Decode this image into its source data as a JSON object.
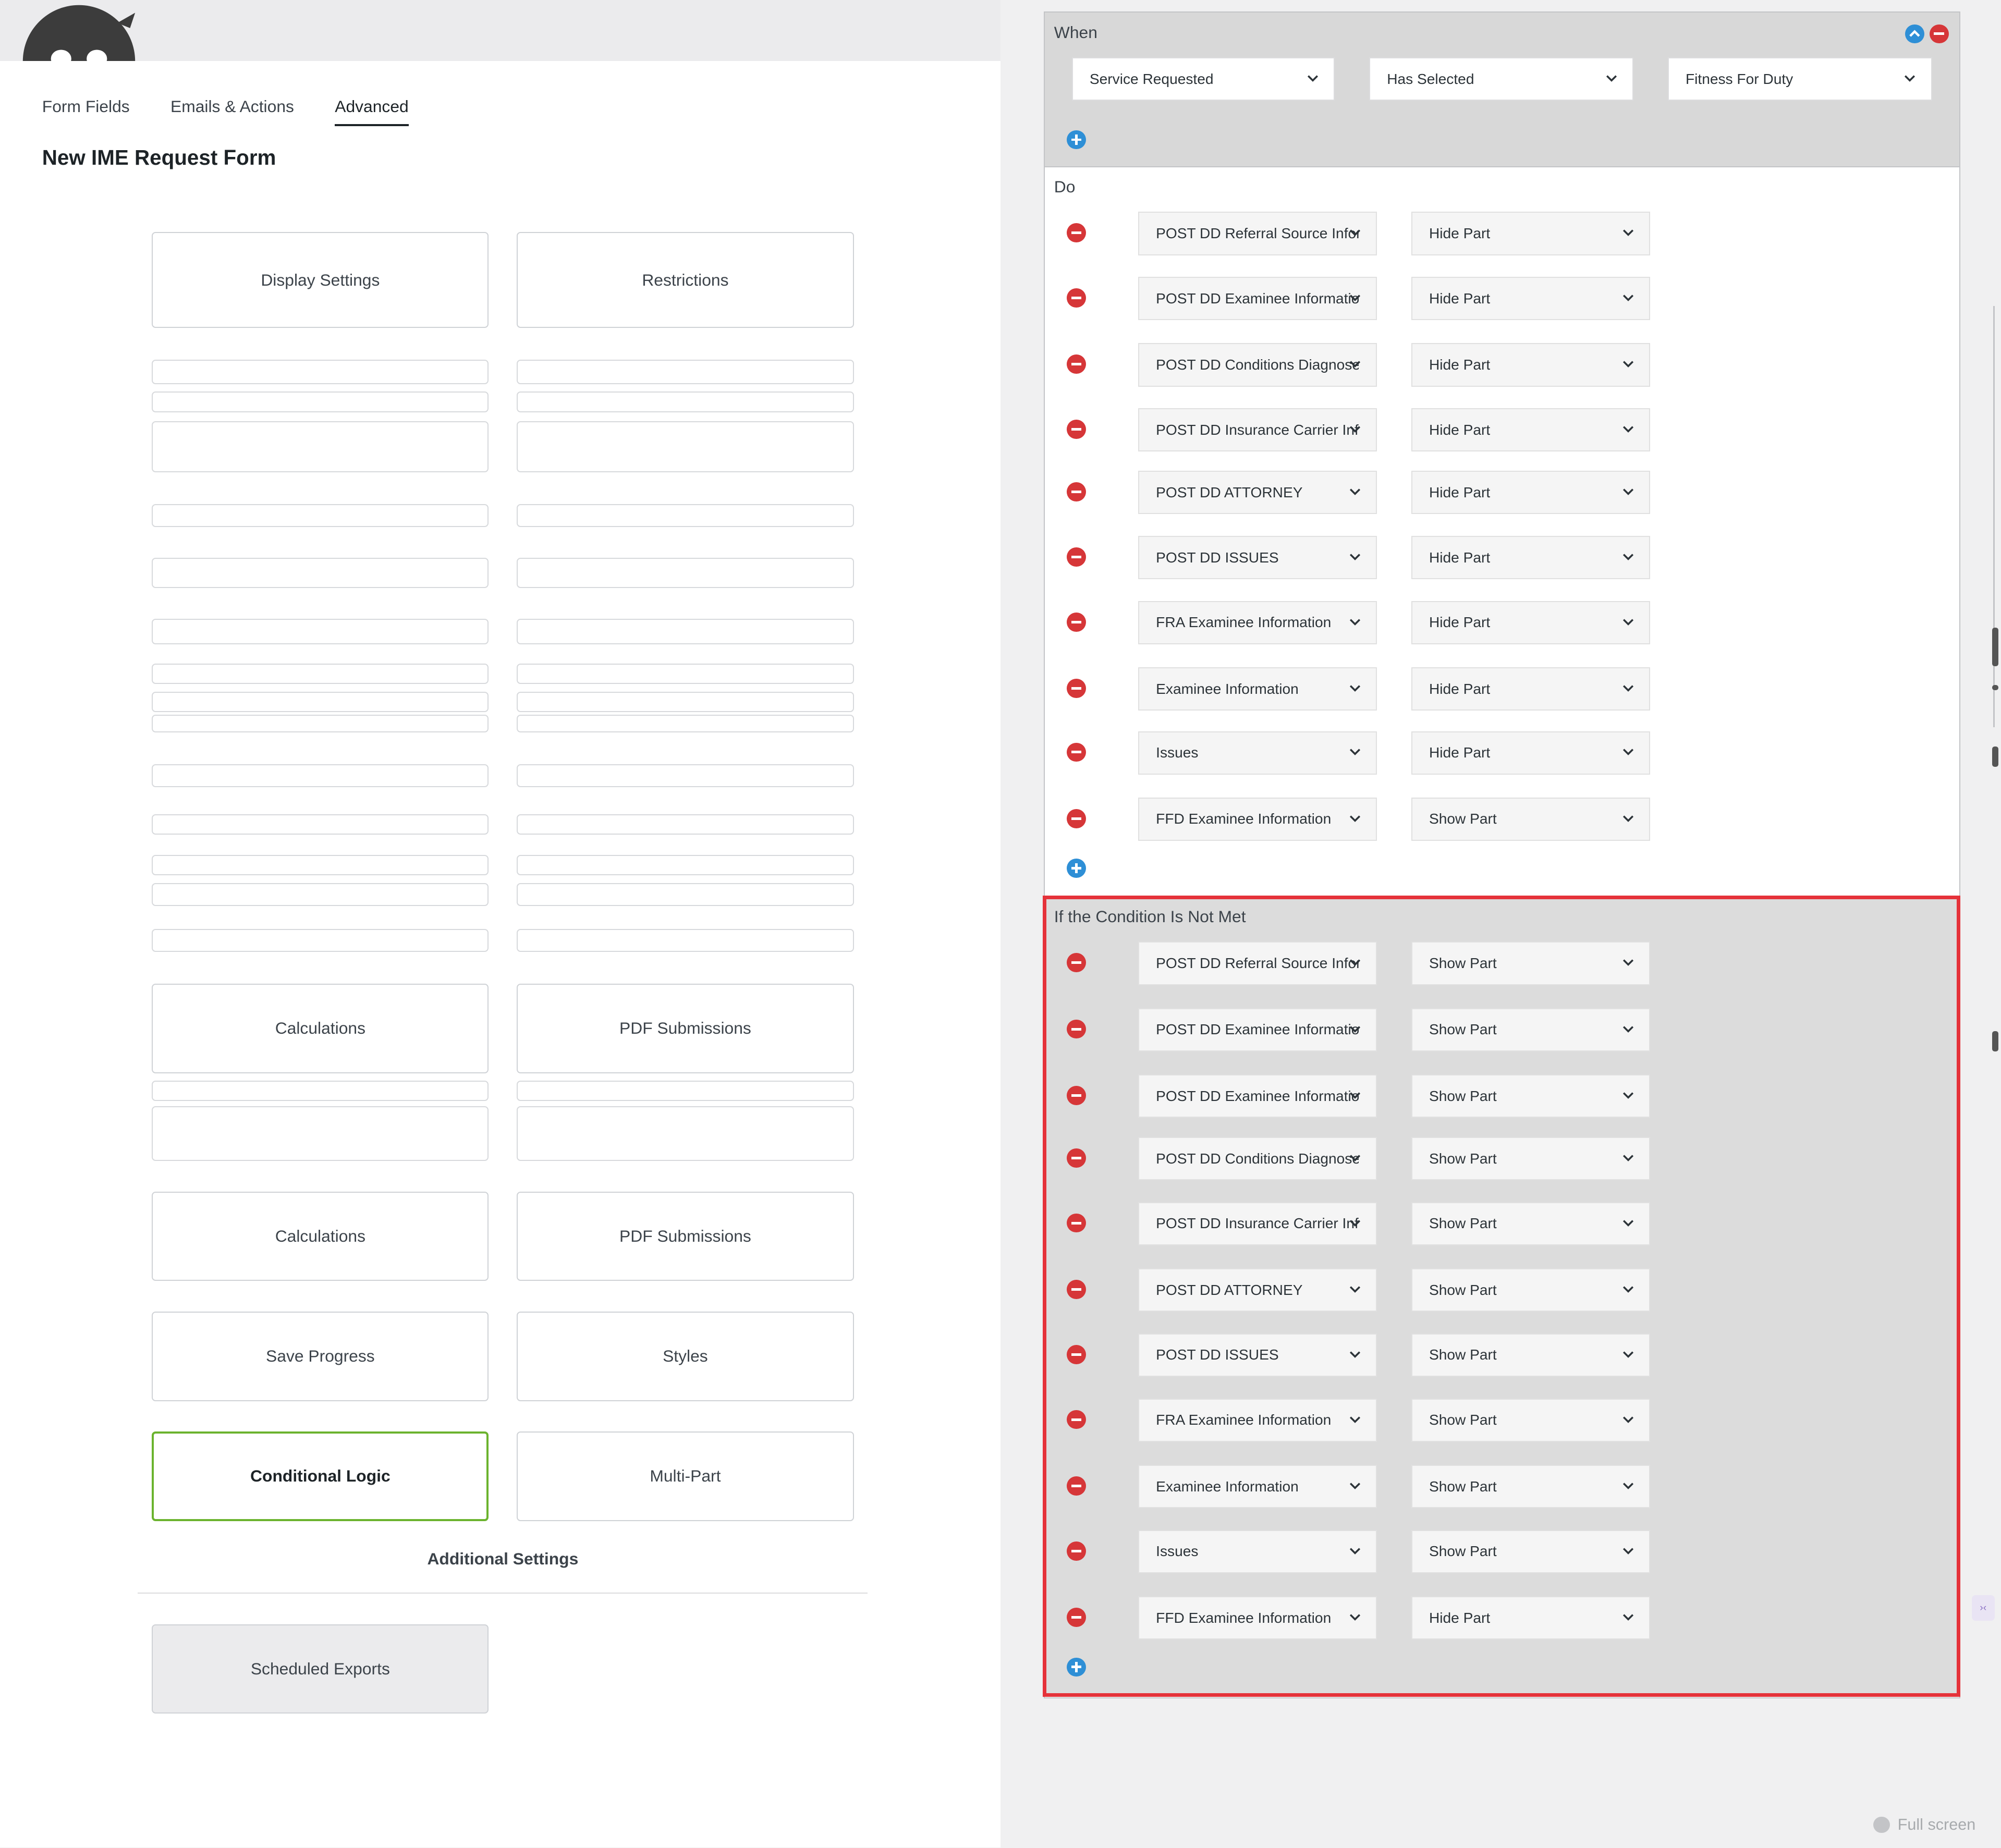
{
  "tabs": [
    "Form Fields",
    "Emails & Actions",
    "Advanced"
  ],
  "form_title": "New IME Request Form",
  "cards": {
    "display_settings": "Display Settings",
    "restrictions": "Restrictions",
    "calculations": "Calculations",
    "pdf_submissions": "PDF Submissions",
    "save_progress": "Save Progress",
    "styles": "Styles",
    "conditional_logic": "Conditional Logic",
    "multi_part": "Multi-Part",
    "additional_settings": "Additional Settings",
    "scheduled_exports": "Scheduled Exports"
  },
  "when": {
    "label": "When",
    "field": "Service Requested",
    "comparator": "Has Selected",
    "value": "Fitness For Duty"
  },
  "do": {
    "label": "Do",
    "rows": [
      {
        "part": "POST DD Referral Source Information",
        "action": "Hide Part"
      },
      {
        "part": "POST DD Examinee Information",
        "action": "Hide Part"
      },
      {
        "part": "POST DD Conditions Diagnosed",
        "action": "Hide Part"
      },
      {
        "part": "POST DD Insurance Carrier Information",
        "action": "Hide Part"
      },
      {
        "part": "POST DD ATTORNEY",
        "action": "Hide Part"
      },
      {
        "part": "POST DD ISSUES",
        "action": "Hide Part"
      },
      {
        "part": "FRA Examinee Information",
        "action": "Hide Part"
      },
      {
        "part": "Examinee Information",
        "action": "Hide Part"
      },
      {
        "part": "Issues",
        "action": "Hide Part"
      },
      {
        "part": "FFD Examinee Information",
        "action": "Show Part"
      }
    ]
  },
  "else": {
    "label": "If the Condition Is Not Met",
    "rows": [
      {
        "part": "POST DD Referral Source Information",
        "action": "Show Part"
      },
      {
        "part": "POST DD Examinee Information",
        "action": "Show Part"
      },
      {
        "part": "POST DD Examinee Information",
        "action": "Show Part"
      },
      {
        "part": "POST DD Conditions Diagnosed",
        "action": "Show Part"
      },
      {
        "part": "POST DD Insurance Carrier Information",
        "action": "Show Part"
      },
      {
        "part": "POST DD ATTORNEY",
        "action": "Show Part"
      },
      {
        "part": "POST DD ISSUES",
        "action": "Show Part"
      },
      {
        "part": "FRA Examinee Information",
        "action": "Show Part"
      },
      {
        "part": "Examinee Information",
        "action": "Show Part"
      },
      {
        "part": "Issues",
        "action": "Show Part"
      },
      {
        "part": "FFD Examinee Information",
        "action": "Hide Part"
      }
    ]
  },
  "fullscreen_label": "Full screen",
  "colors": {
    "accent_green": "#6bb32e",
    "remove_red": "#d63638",
    "add_blue": "#2e8fd6",
    "highlight_red": "#e5323a"
  }
}
